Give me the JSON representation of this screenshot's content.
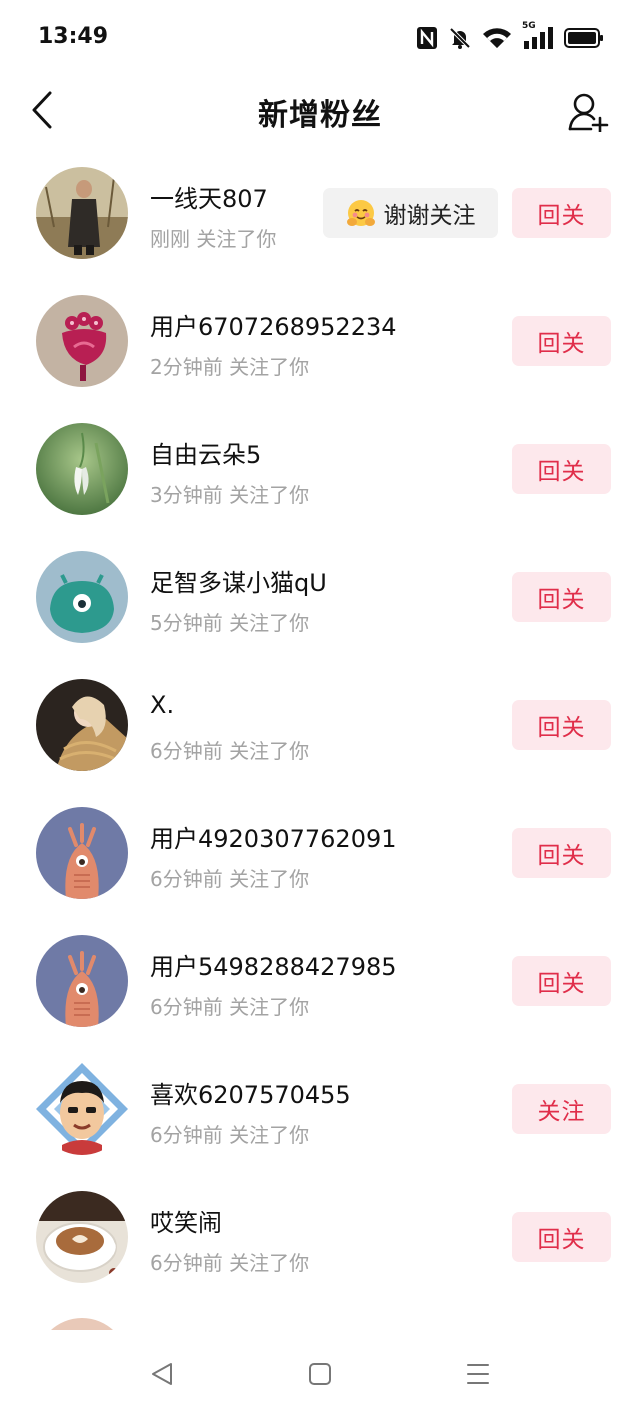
{
  "status_bar": {
    "time": "13:49",
    "icons": [
      "nfc-icon",
      "bell-muted-icon",
      "wifi-icon",
      "signal-5g-icon",
      "battery-icon"
    ],
    "network_label": "5G"
  },
  "header": {
    "title": "新增粉丝",
    "back_icon": "chevron-left-icon",
    "add_friend_icon": "add-user-icon"
  },
  "thanks_button": {
    "label": "谢谢关注",
    "emoji_icon": "hug-emoji-icon"
  },
  "followers": [
    {
      "name": "一线天807",
      "time": "刚刚",
      "action": "关注了你",
      "button": "回关",
      "avatar": "man-in-coat-photo"
    },
    {
      "name": "用户6707268952234",
      "time": "2分钟前",
      "action": "关注了你",
      "button": "回关",
      "avatar": "red-cartoon-creature"
    },
    {
      "name": "自由云朵5",
      "time": "3分钟前",
      "action": "关注了你",
      "button": "回关",
      "avatar": "snowdrop-flower-photo"
    },
    {
      "name": "足智多谋小猫qU",
      "time": "5分钟前",
      "action": "关注了你",
      "button": "回关",
      "avatar": "teal-one-eyed-monster"
    },
    {
      "name": "X.",
      "time": "6分钟前",
      "action": "关注了你",
      "button": "回关",
      "avatar": "girl-with-harp-photo"
    },
    {
      "name": "用户4920307762091",
      "time": "6分钟前",
      "action": "关注了你",
      "button": "回关",
      "avatar": "one-eyed-creature-default"
    },
    {
      "name": "用户5498288427985",
      "time": "6分钟前",
      "action": "关注了你",
      "button": "回关",
      "avatar": "one-eyed-creature-default"
    },
    {
      "name": "喜欢6207570455",
      "time": "6分钟前",
      "action": "关注了你",
      "button": "关注",
      "avatar": "cartoon-boy-portrait"
    },
    {
      "name": "哎笑闹",
      "time": "6分钟前",
      "action": "关注了你",
      "button": "回关",
      "avatar": "latte-coffee-photo"
    }
  ],
  "bottom_nav": {
    "back_key_icon": "triangle-back-icon",
    "home_key_icon": "square-home-icon",
    "menu_key_icon": "three-lines-menu-icon"
  },
  "colors": {
    "accent": "#e02e4a",
    "accent_bg": "#fde8ec",
    "secondary_text": "#a3a3a3",
    "thanks_bg": "#f2f2f2"
  }
}
